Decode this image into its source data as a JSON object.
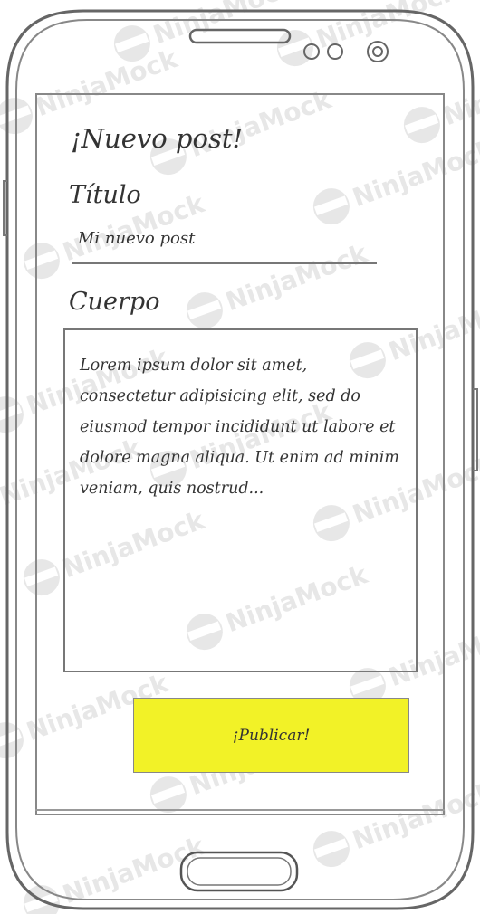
{
  "page": {
    "title": "¡Nuevo post!"
  },
  "form": {
    "title_label": "Título",
    "title_value": "Mi nuevo post",
    "body_label": "Cuerpo",
    "body_value": "Lorem ipsum dolor sit amet, consectetur adipisicing elit, sed do eiusmod tempor incididunt ut labore et dolore magna aliqua. Ut enim ad minim veniam, quis nostrud..."
  },
  "actions": {
    "publish_label": "¡Publicar!"
  },
  "watermark": {
    "text": "NinjaMock"
  },
  "colors": {
    "publish_button": "#f2f227",
    "phone_outline": "#666666",
    "watermark": "#e6e6e6"
  }
}
